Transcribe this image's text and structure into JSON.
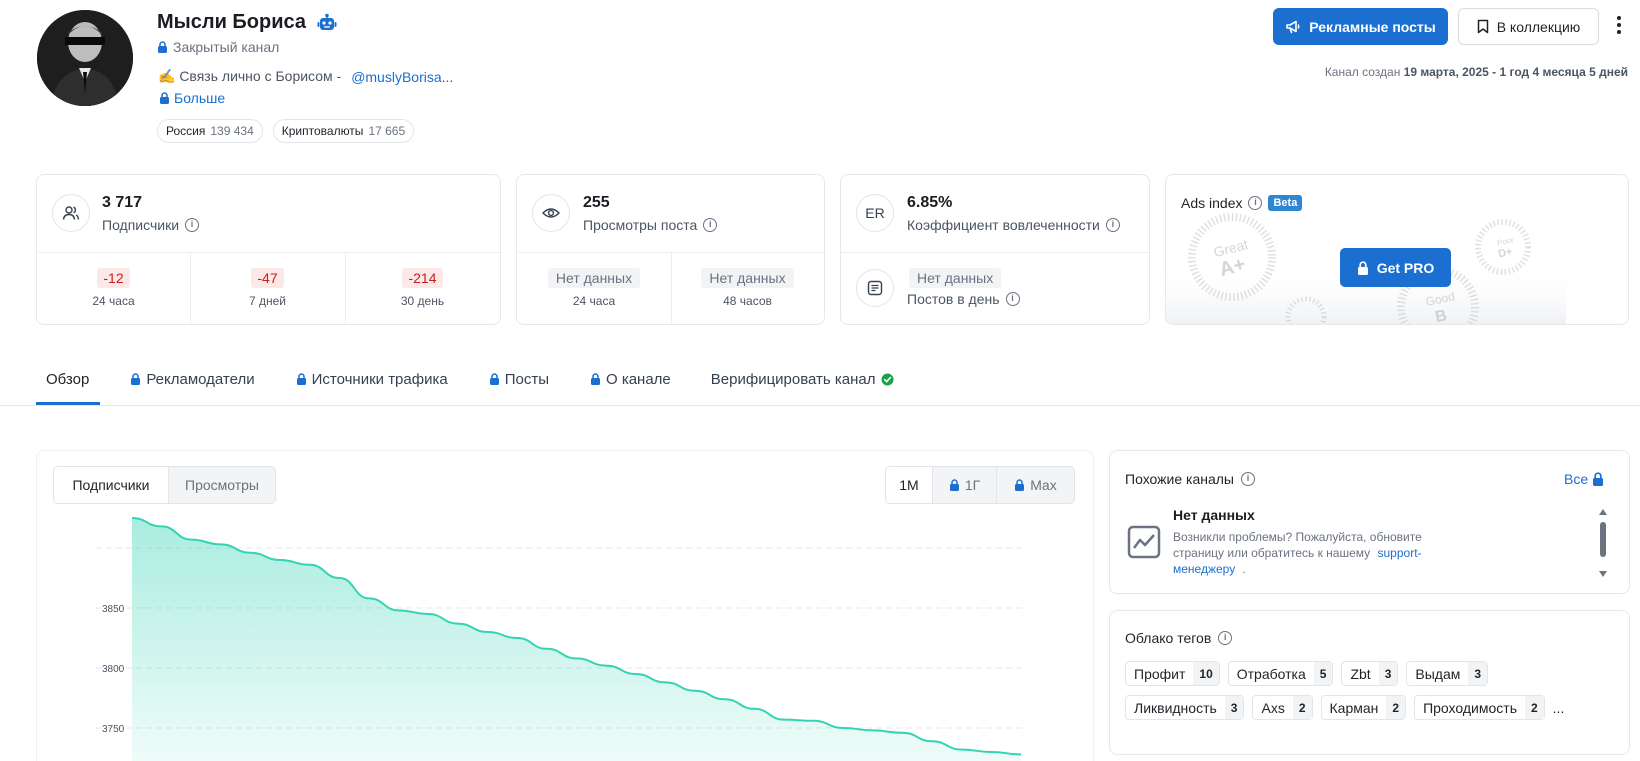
{
  "channel": {
    "title": "Мысли Бориса",
    "type": "Закрытый канал",
    "contact_prefix": "✍️ Связь лично с Борисом -",
    "contact_handle": "@muslyBorisa",
    "contact_suffix": "...",
    "more": "Больше",
    "tags": [
      {
        "name": "Россия",
        "count": "139 434"
      },
      {
        "name": "Криптовалюты",
        "count": "17 665"
      }
    ],
    "created_prefix": "Канал создан",
    "created_date": "19 марта, 2025 - 1 год 4 месяца 5 дней"
  },
  "actions": {
    "ads_posts": "Рекламные посты",
    "to_collection": "В коллекцию"
  },
  "stats": {
    "subscribers": {
      "value": "3 717",
      "label": "Подписчики",
      "changes": [
        {
          "value": "-12",
          "period": "24 часа"
        },
        {
          "value": "-47",
          "period": "7 дней"
        },
        {
          "value": "-214",
          "period": "30 день"
        }
      ]
    },
    "views": {
      "value": "255",
      "label": "Просмотры поста",
      "changes": [
        {
          "value": "Нет данных",
          "period": "24 часа"
        },
        {
          "value": "Нет данных",
          "period": "48 часов"
        }
      ]
    },
    "er": {
      "icon_text": "ER",
      "value": "6.85%",
      "label": "Коэффициент вовлеченности",
      "posts_value": "Нет данных",
      "posts_label": "Постов в день"
    },
    "ads_index": {
      "label": "Ads index",
      "badge": "Beta",
      "button": "Get PRO",
      "grades": [
        "Great",
        "A+",
        "Good",
        "B",
        "Poor",
        "D+"
      ]
    }
  },
  "tabs": [
    {
      "label": "Обзор",
      "locked": false
    },
    {
      "label": "Рекламодатели",
      "locked": true
    },
    {
      "label": "Источники трафика",
      "locked": true
    },
    {
      "label": "Посты",
      "locked": true
    },
    {
      "label": "О канале",
      "locked": true
    },
    {
      "label": "Верифицировать канал",
      "locked": false
    }
  ],
  "chart_panel": {
    "metric_tabs": [
      "Подписчики",
      "Просмотры"
    ],
    "range_tabs": [
      "1M",
      "1Г",
      "Max"
    ]
  },
  "chart_data": {
    "type": "area",
    "xlabel": "",
    "ylabel": "",
    "y_ticks": [
      3750,
      3800,
      3850,
      3900
    ],
    "y_tick_labels": [
      "3750",
      "3800",
      "3850",
      ""
    ],
    "grid": true,
    "color": "#34d3b4",
    "x": [
      0,
      1,
      2,
      3,
      4,
      5,
      6,
      7,
      8,
      9,
      10,
      11,
      12,
      13,
      14,
      15,
      16,
      17,
      18,
      19,
      20,
      21,
      22,
      23,
      24,
      25,
      26,
      27,
      28,
      29,
      30
    ],
    "values": [
      3925,
      3918,
      3907,
      3903,
      3896,
      3890,
      3886,
      3875,
      3858,
      3848,
      3845,
      3837,
      3830,
      3825,
      3816,
      3808,
      3802,
      3795,
      3788,
      3781,
      3774,
      3766,
      3757,
      3756,
      3750,
      3748,
      3746,
      3739,
      3732,
      3730,
      3728
    ]
  },
  "similar": {
    "title": "Похожие каналы",
    "all": "Все",
    "empty_title": "Нет данных",
    "empty_text": "Возникли проблемы? Пожалуйста, обновите страницу или обратитесь к нашему",
    "empty_link": "support-менеджеру",
    "empty_end": "."
  },
  "tag_cloud": {
    "title": "Облако тегов",
    "tags": [
      {
        "tag": "Профит",
        "count": "10"
      },
      {
        "tag": "Отработка",
        "count": "5"
      },
      {
        "tag": "Zbt",
        "count": "3"
      },
      {
        "tag": "Выдам",
        "count": "3"
      },
      {
        "tag": "Ликвидность",
        "count": "3"
      },
      {
        "tag": "Axs",
        "count": "2"
      },
      {
        "tag": "Карман",
        "count": "2"
      },
      {
        "tag": "Проходимость",
        "count": "2"
      }
    ],
    "more": "..."
  },
  "colors": {
    "accent": "#1b6fd1",
    "negative_bg": "#fde8e8",
    "negative_text": "#c81e1e",
    "chart": "#34d3b4",
    "beta": "#2f86d1"
  }
}
